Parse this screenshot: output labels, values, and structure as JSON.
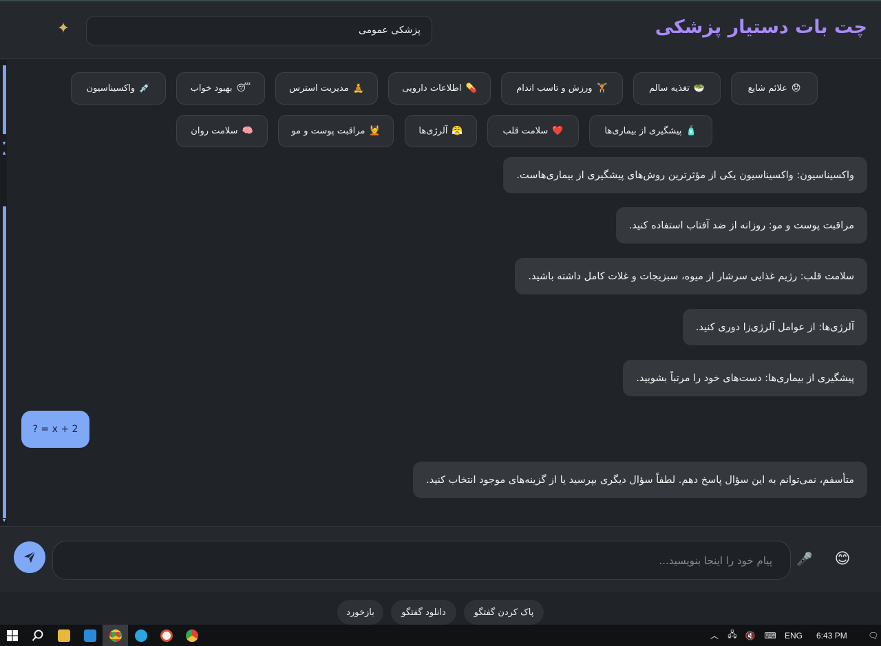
{
  "header": {
    "title": "چت بات دستیار پزشکی",
    "specialty_value": "پزشکی عمومی",
    "sparkle_icon": "✦"
  },
  "chips": [
    {
      "emoji": "😟",
      "label": "علائم شایع"
    },
    {
      "emoji": "🥗",
      "label": "تغذیه سالم"
    },
    {
      "emoji": "🏋️",
      "label": "ورزش و تاسب اندام"
    },
    {
      "emoji": "💊",
      "label": "اطلاعات دارویی"
    },
    {
      "emoji": "🧘",
      "label": "مدیریت استرس"
    },
    {
      "emoji": "😴",
      "label": "بهبود خواب"
    },
    {
      "emoji": "💉",
      "label": "واکسیناسیون"
    },
    {
      "emoji": "🧴",
      "label": "پیشگیری از بیماری‌ها"
    },
    {
      "emoji": "❤️",
      "label": "سلامت قلب"
    },
    {
      "emoji": "😤",
      "label": "آلرژی‌ها"
    },
    {
      "emoji": "💆",
      "label": "مراقبت پوست و مو"
    },
    {
      "emoji": "🧠",
      "label": "سلامت روان"
    }
  ],
  "messages": [
    {
      "text": "واکسیناسیون: واکسیناسیون یکی از مؤثرترین روش‌های پیشگیری از بیماری‌هاست."
    },
    {
      "text": "مراقبت پوست و مو: روزانه از ضد آفتاب استفاده کنید."
    },
    {
      "text": "سلامت قلب: رژیم غذایی سرشار از میوه، سبزیجات و غلات کامل داشته باشید."
    },
    {
      "text": "آلرژی‌ها: از عوامل آلرژی‌زا دوری کنید."
    },
    {
      "text": "پیشگیری از بیماری‌ها: دست‌های خود را مرتباً بشویید."
    },
    {
      "text": "متأسفم، نمی‌توانم به این سؤال پاسخ دهم. لطفاً سؤال دیگری بپرسید یا از گزینه‌های موجود انتخاب کنید."
    }
  ],
  "user_message": "? = x + 2",
  "input": {
    "placeholder": "پیام خود را اینجا بنویسید...",
    "value": ""
  },
  "actions": {
    "clear": "پاک کردن گفتگو",
    "download": "دانلود گفتگو",
    "feedback": "بازخورد"
  },
  "taskbar": {
    "language": "ENG",
    "time": "6:43 PM"
  },
  "colors": {
    "accent": "#a78bfa",
    "user_bubble": "#7fa9f7",
    "bot_bubble": "#35393e"
  }
}
